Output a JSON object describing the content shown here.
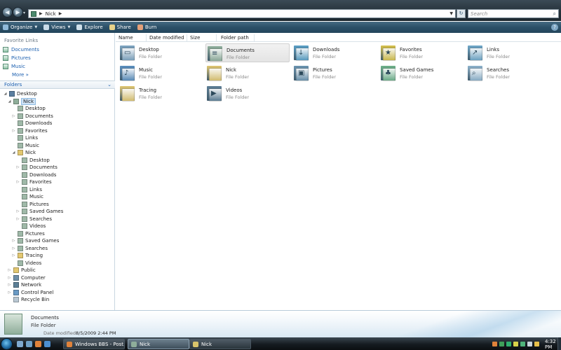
{
  "window": {
    "breadcrumb": [
      "Nick"
    ],
    "search_placeholder": "Search"
  },
  "toolbar": {
    "items": [
      {
        "label": "Organize",
        "icon": "organize-icon",
        "has_dropdown": true,
        "color": "#8fb9d9"
      },
      {
        "label": "Views",
        "icon": "views-icon",
        "has_dropdown": true,
        "color": "#c9dbe8"
      },
      {
        "label": "Explore",
        "icon": "explore-icon",
        "has_dropdown": false,
        "color": "#cfe0ea"
      },
      {
        "label": "Share",
        "icon": "share-icon",
        "has_dropdown": false,
        "color": "#e7d28a"
      },
      {
        "label": "Burn",
        "icon": "burn-icon",
        "has_dropdown": false,
        "color": "#e3a07a"
      }
    ],
    "help_label": "?"
  },
  "navpane": {
    "favorites_heading": "Favorite Links",
    "favorites": [
      {
        "label": "Documents",
        "icon": "documents-icon"
      },
      {
        "label": "Pictures",
        "icon": "pictures-icon"
      },
      {
        "label": "Music",
        "icon": "music-icon"
      }
    ],
    "more_label": "More »",
    "folders_heading": "Folders",
    "tree": [
      {
        "label": "Desktop",
        "level": 0,
        "expander": "open",
        "icon": "desktop-icon"
      },
      {
        "label": "Nick",
        "level": 1,
        "expander": "open",
        "icon": "user-folder-icon",
        "selected": true
      },
      {
        "label": "Desktop",
        "level": 2,
        "expander": "",
        "icon": "desktop-folder-icon"
      },
      {
        "label": "Documents",
        "level": 2,
        "expander": "closed",
        "icon": "documents-folder-icon"
      },
      {
        "label": "Downloads",
        "level": 2,
        "expander": "",
        "icon": "downloads-folder-icon"
      },
      {
        "label": "Favorites",
        "level": 2,
        "expander": "closed",
        "icon": "favorites-folder-icon"
      },
      {
        "label": "Links",
        "level": 2,
        "expander": "",
        "icon": "links-folder-icon"
      },
      {
        "label": "Music",
        "level": 2,
        "expander": "",
        "icon": "music-folder-icon"
      },
      {
        "label": "Nick",
        "level": 2,
        "expander": "open",
        "icon": "folder-icon"
      },
      {
        "label": "Desktop",
        "level": 3,
        "expander": "",
        "icon": "desktop-folder-icon"
      },
      {
        "label": "Documents",
        "level": 3,
        "expander": "closed",
        "icon": "documents-folder-icon"
      },
      {
        "label": "Downloads",
        "level": 3,
        "expander": "",
        "icon": "downloads-folder-icon"
      },
      {
        "label": "Favorites",
        "level": 3,
        "expander": "closed",
        "icon": "favorites-folder-icon"
      },
      {
        "label": "Links",
        "level": 3,
        "expander": "",
        "icon": "links-folder-icon"
      },
      {
        "label": "Music",
        "level": 3,
        "expander": "",
        "icon": "music-folder-icon"
      },
      {
        "label": "Pictures",
        "level": 3,
        "expander": "",
        "icon": "pictures-folder-icon"
      },
      {
        "label": "Saved Games",
        "level": 3,
        "expander": "closed",
        "icon": "saved-games-folder-icon"
      },
      {
        "label": "Searches",
        "level": 3,
        "expander": "closed",
        "icon": "searches-folder-icon"
      },
      {
        "label": "Videos",
        "level": 3,
        "expander": "",
        "icon": "videos-folder-icon"
      },
      {
        "label": "Pictures",
        "level": 2,
        "expander": "",
        "icon": "pictures-folder-icon"
      },
      {
        "label": "Saved Games",
        "level": 2,
        "expander": "closed",
        "icon": "saved-games-folder-icon"
      },
      {
        "label": "Searches",
        "level": 2,
        "expander": "closed",
        "icon": "searches-folder-icon"
      },
      {
        "label": "Tracing",
        "level": 2,
        "expander": "closed",
        "icon": "folder-icon"
      },
      {
        "label": "Videos",
        "level": 2,
        "expander": "",
        "icon": "videos-folder-icon"
      },
      {
        "label": "Public",
        "level": 1,
        "expander": "closed",
        "icon": "public-folder-icon"
      },
      {
        "label": "Computer",
        "level": 1,
        "expander": "closed",
        "icon": "computer-icon"
      },
      {
        "label": "Network",
        "level": 1,
        "expander": "closed",
        "icon": "network-icon"
      },
      {
        "label": "Control Panel",
        "level": 1,
        "expander": "closed",
        "icon": "control-panel-icon"
      },
      {
        "label": "Recycle Bin",
        "level": 1,
        "expander": "",
        "icon": "recycle-bin-icon"
      }
    ]
  },
  "columns": [
    "Name",
    "Date modified",
    "Size",
    "Folder path"
  ],
  "content": {
    "items": [
      {
        "name": "Desktop",
        "type": "File Folder",
        "icon": "desktop-folder-icon",
        "color": "#7fa6c2"
      },
      {
        "name": "Documents",
        "type": "File Folder",
        "icon": "documents-folder-icon",
        "color": "#8fae9a",
        "selected": true
      },
      {
        "name": "Downloads",
        "type": "File Folder",
        "icon": "downloads-folder-icon",
        "color": "#5aa0c6"
      },
      {
        "name": "Favorites",
        "type": "File Folder",
        "icon": "favorites-folder-icon",
        "color": "#d8c24a"
      },
      {
        "name": "Links",
        "type": "File Folder",
        "icon": "links-folder-icon",
        "color": "#6fa8c9"
      },
      {
        "name": "Music",
        "type": "File Folder",
        "icon": "music-folder-icon",
        "color": "#5b8fbf"
      },
      {
        "name": "Nick",
        "type": "File Folder",
        "icon": "folder-icon",
        "color": "#e2c770"
      },
      {
        "name": "Pictures",
        "type": "File Folder",
        "icon": "pictures-folder-icon",
        "color": "#6b94b0"
      },
      {
        "name": "Saved Games",
        "type": "File Folder",
        "icon": "saved-games-folder-icon",
        "color": "#6fb38a"
      },
      {
        "name": "Searches",
        "type": "File Folder",
        "icon": "searches-folder-icon",
        "color": "#8eb3cc"
      },
      {
        "name": "Tracing",
        "type": "File Folder",
        "icon": "folder-icon",
        "color": "#e2c770"
      },
      {
        "name": "Videos",
        "type": "File Folder",
        "icon": "videos-folder-icon",
        "color": "#5e7f96"
      }
    ]
  },
  "details": {
    "name": "Documents",
    "type": "File Folder",
    "date_label": "Date modified:",
    "date_value": "8/5/2009 2:44 PM"
  },
  "taskbar": {
    "quick_launch": [
      {
        "icon": "show-desktop-icon",
        "color": "#7fa9cf"
      },
      {
        "icon": "switch-windows-icon",
        "color": "#6fa0c7"
      },
      {
        "icon": "firefox-icon",
        "color": "#e0823a"
      },
      {
        "icon": "media-player-icon",
        "color": "#4c8fd1"
      }
    ],
    "buttons": [
      {
        "label": "Windows BBS - Post...",
        "icon": "firefox-icon",
        "color": "#e0823a",
        "active": false
      },
      {
        "label": "Nick",
        "icon": "explorer-icon",
        "color": "#8fae9a",
        "active": true
      },
      {
        "label": "Nick",
        "icon": "explorer-icon",
        "color": "#d9c46b",
        "active": false
      }
    ],
    "tray_icons": [
      {
        "icon": "tray-app-icon",
        "color": "#e0823a"
      },
      {
        "icon": "tray-app-icon",
        "color": "#3fa05a"
      },
      {
        "icon": "tray-app-icon",
        "color": "#2fb06f"
      },
      {
        "icon": "tray-app-icon",
        "color": "#d8d14a"
      },
      {
        "icon": "network-tray-icon",
        "color": "#4fb37a"
      },
      {
        "icon": "volume-icon",
        "color": "#c7d3dc"
      },
      {
        "icon": "power-icon",
        "color": "#e7c04a"
      }
    ],
    "clock": "4:32 PM"
  }
}
